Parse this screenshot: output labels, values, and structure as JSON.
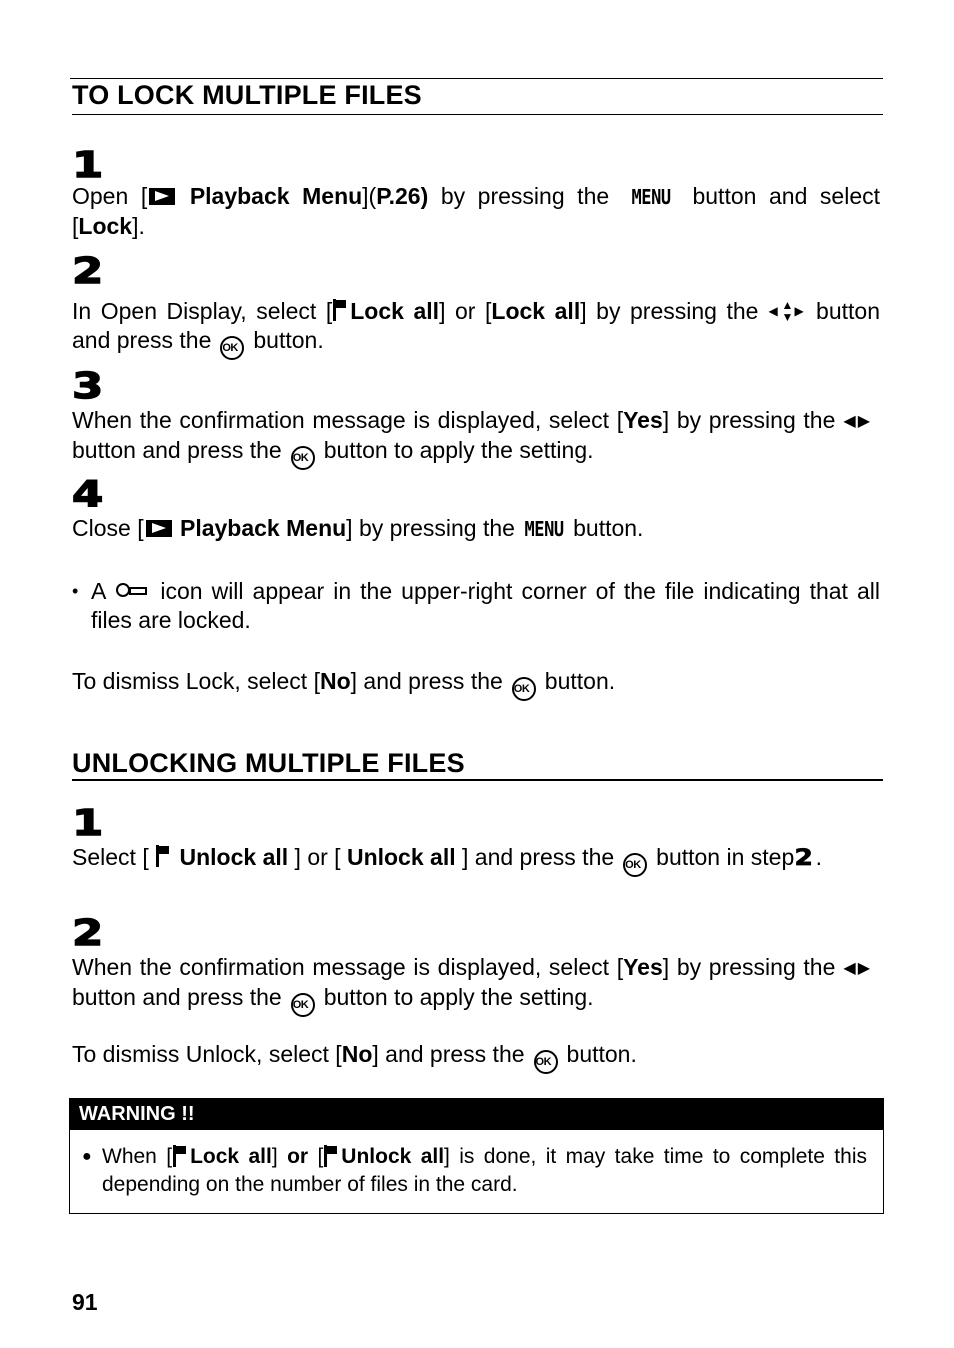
{
  "page_number": "91",
  "sections": {
    "lock": {
      "title": "TO LOCK MULTIPLE FILES",
      "steps": [
        {
          "number": "1",
          "t1": "Open [",
          "t2": "Playback Menu",
          "t3": "](",
          "t4": "P.26)",
          "t5": " by pressing the ",
          "menu": "MENU",
          "t6": " button and select [",
          "t7": "Lock",
          "t8": "]."
        },
        {
          "number": "2",
          "t1": "In Open Display, select [",
          "t2": "Lock all",
          "t3": "] or [",
          "t4": "Lock all",
          "t5": "] by pressing the",
          "t6": "button and press the",
          "ok": "OK",
          "t7": "button."
        },
        {
          "number": "3",
          "t1": "When the confirmation message is displayed, select [",
          "t2": "Yes",
          "t3": "] by pressing the",
          "t4": "button and press the",
          "ok": "OK",
          "t5": "button to apply the setting."
        },
        {
          "number": "4",
          "t1": "Close [",
          "t2": "Playback Menu",
          "t3": "] by pressing the",
          "menu": "MENU",
          "t4": "button."
        }
      ],
      "note": {
        "t1": "A",
        "t2": "icon will appear in the upper-right corner of the file indicating that all files are locked."
      },
      "dismiss": {
        "t1": "To dismiss Lock, select [",
        "t2": "No",
        "t3": "] and press the",
        "ok": "OK",
        "t4": "button."
      }
    },
    "unlock": {
      "title": "UNLOCKING MULTIPLE FILES",
      "steps": [
        {
          "number": "1",
          "t1": "Select [",
          "t2": "Unlock all",
          "t3": "] or [",
          "t4": "Unlock all",
          "t5": "] and press the",
          "ok": "OK",
          "t6": "button in step",
          "step_ref": "2",
          "t7": "."
        },
        {
          "number": "2",
          "t1": "When the confirmation message is displayed, select [",
          "t2": "Yes",
          "t3": "] by pressing the",
          "t4": "button and press the",
          "ok": "OK",
          "t5": "button to apply the setting."
        }
      ],
      "dismiss": {
        "t1": "To dismiss Unlock, select [",
        "t2": "No",
        "t3": "] and press the",
        "ok": "OK",
        "t4": "button."
      }
    }
  },
  "warning": {
    "title": "WARNING !!",
    "t1": "When [",
    "t2": "Lock all",
    "t3": "]",
    "t4": "or",
    "t5": "[",
    "t6": "Unlock all",
    "t7": "] is done, it may take time to complete this depending on the number of files in the card."
  },
  "icons": {
    "playback": "playback-menu-icon",
    "menu": "menu-button-glyph",
    "ok": "ok-button-icon",
    "flag": "flag-icon",
    "arrows_lr": "left-right-arrows-icon",
    "arrows_4": "four-way-arrows-icon",
    "key": "lock-key-icon"
  }
}
